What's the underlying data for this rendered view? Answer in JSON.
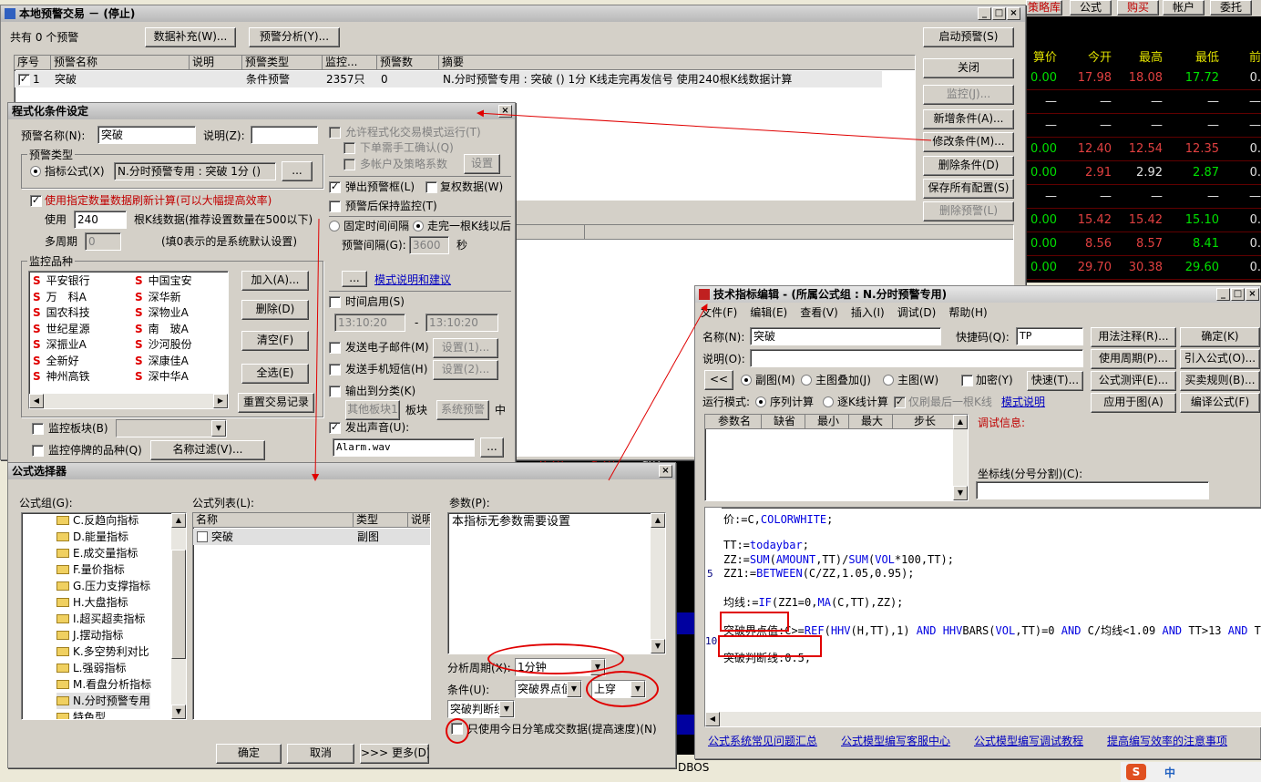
{
  "top_tabs": [
    "策略库",
    "公式",
    "购买",
    "帐户",
    "委托"
  ],
  "quote_header": [
    "算价",
    "今开",
    "最高",
    "最低",
    "前"
  ],
  "quote_rows": [
    [
      "0.00",
      "17.98",
      "18.08",
      "17.72",
      "0."
    ],
    [
      "—",
      "—",
      "—",
      "—",
      "—"
    ],
    [
      "—",
      "—",
      "—",
      "—",
      "—"
    ],
    [
      "0.00",
      "12.40",
      "12.54",
      "12.35",
      "0."
    ],
    [
      "0.00",
      "2.91",
      "2.92",
      "2.87",
      "0."
    ],
    [
      "—",
      "—",
      "—",
      "—",
      "—"
    ],
    [
      "0.00",
      "15.42",
      "15.42",
      "15.10",
      "0."
    ],
    [
      "0.00",
      "8.56",
      "8.57",
      "8.41",
      "0."
    ],
    [
      "0.00",
      "29.70",
      "30.38",
      "29.60",
      "0."
    ]
  ],
  "main_window": {
    "title": "本地预警交易 － (停止)",
    "count_label": "共有 0 个预警",
    "btn_supplement": "数据补充(W)...",
    "btn_analysis": "预警分析(Y)...",
    "btn_start": "启动预警(S)",
    "columns": [
      "序号",
      "预警名称",
      "说明",
      "预警类型",
      "监控...",
      "预警数",
      "摘要"
    ],
    "row": {
      "id": "1",
      "name": "突破",
      "desc": "",
      "type": "条件预警",
      "monitor": "2357只",
      "count": "0",
      "summary": "N.分时预警专用 : 突破 () 1分 K线走完再发信号 使用240根K线数据计算"
    },
    "right_buttons": [
      "关闭",
      "监控(J)...",
      "新增条件(A)...",
      "修改条件(M)...",
      "删除条件(D)",
      "保存所有配置(S)",
      "删除预警(L)"
    ]
  },
  "cond_dialog": {
    "title": "程式化条件设定",
    "name_label": "预警名称(N):",
    "name_value": "突破",
    "desc_label": "说明(Z):",
    "type_group": "预警类型",
    "formula_radio": "指标公式(X)",
    "formula_value": "N.分时预警专用 : 突破 1分 ()",
    "more": "...",
    "use_count_check": "使用指定数量数据刷新计算(可以大幅提高效率)",
    "use_label": "使用",
    "use_value": "240",
    "kline_label": "根K线数据(推荐设置数量在500以下)",
    "multi_label": "多周期",
    "multi_value": "0",
    "multi_note": "(填0表示的是系统默认设置)",
    "stock_group": "监控品种",
    "stocks_left": [
      "平安银行",
      "万　科A",
      "国农科技",
      "世纪星源",
      "深振业A",
      "全新好",
      "神州高铁"
    ],
    "stocks_right": [
      "中国宝安",
      "深华新",
      "深物业A",
      "南　玻A",
      "沙河股份",
      "深康佳A",
      "深中华A"
    ],
    "stock_buttons": [
      "加入(A)...",
      "删除(D)",
      "清空(F)",
      "全选(E)",
      "重置交易记录"
    ],
    "monitor_block": "监控板块(B)",
    "monitor_halted": "监控停牌的品种(Q)",
    "name_filter": "名称过滤(V)...",
    "allow_prog": "允许程式化交易模式运行(T)",
    "manual_confirm": "下单需手工确认(Q)",
    "multi_account": "多帐户及策略系数",
    "setup": "设置",
    "popup": "弹出预警框(L)",
    "rights": "复权数据(W)",
    "keep_monitor": "预警后保持监控(T)",
    "fixed_interval": "固定时间间隔",
    "bar_complete": "走完一根K线以后",
    "interval_label": "预警间隔(G):",
    "interval_value": "3600",
    "sec": "秒",
    "mode_link": "模式说明和建议",
    "time_enable": "时间启用(S)",
    "time_from": "13:10:20",
    "time_to": "13:10:20",
    "dash": "-",
    "send_email": "发送电子邮件(M)",
    "email_setup": "设置(1)...",
    "send_sms": "发送手机短信(H)",
    "sms_setup": "设置(2)...",
    "output_cat": "输出到分类(K)",
    "other_block": "其他板块1",
    "block_label": "板块",
    "sys_alert": "系统预警",
    "mid": "中",
    "sound": "发出声音(U):",
    "sound_file": "Alarm.wav"
  },
  "formula_selector": {
    "title": "公式选择器",
    "group_label": "公式组(G):",
    "groups": [
      "C.反趋向指标",
      "D.能量指标",
      "E.成交量指标",
      "F.量价指标",
      "G.压力支撑指标",
      "H.大盘指标",
      "I.超买超卖指标",
      "J.摆动指标",
      "K.多空势利对比",
      "L.强弱指标",
      "M.看盘分析指标",
      "N.分时预警专用",
      "特色型"
    ],
    "list_label": "公式列表(L):",
    "list_columns": [
      "名称",
      "类型",
      "说明"
    ],
    "list_row": {
      "name": "突破",
      "type": "副图"
    },
    "param_label": "参数(P):",
    "param_text": "本指标无参数需要设置",
    "period_label": "分析周期(X):",
    "period_value": "1分钟",
    "cond_label": "条件(U):",
    "cond_value": "突破界点值",
    "cross_value": "上穿",
    "line_value": "突破判断线",
    "only_today": "只使用今日分笔成交数据(提高速度)(N)",
    "ok": "确定",
    "cancel": "取消",
    "more": ">>> 更多(D)"
  },
  "editor": {
    "title": "技术指标编辑 - (所属公式组 : N.分时预警专用)",
    "menu": [
      "文件(F)",
      "编辑(E)",
      "查看(V)",
      "插入(I)",
      "调试(D)",
      "帮助(H)"
    ],
    "name_label": "名称(N):",
    "name_value": "突破",
    "shortcut_label": "快捷码(Q):",
    "shortcut_value": "TP",
    "desc_label": "说明(O):",
    "btn_usage": "用法注释(R)...",
    "btn_ok": "确定(K)",
    "btn_period": "使用周期(P)...",
    "btn_import": "引入公式(O)...",
    "btn_test": "公式测评(E)...",
    "btn_rules": "买卖规则(B)...",
    "btn_apply": "应用于图(A)",
    "btn_compile": "编译公式(F)",
    "nav": "<<",
    "r_sub": "副图(M)",
    "r_overlay": "主图叠加(J)",
    "r_main": "主图(W)",
    "encrypt": "加密(Y)",
    "quick": "快速(T)...",
    "run_mode": "运行模式:",
    "r_seq": "序列计算",
    "r_kline": "逐K线计算",
    "only_last": "仅刷最后一根K线",
    "mode_link": "模式说明",
    "param_cols": [
      "参数名",
      "缺省",
      "最小",
      "最大",
      "步长"
    ],
    "debug_label": "调试信息:",
    "coord_label": "坐标线(分号分割)(C):",
    "line5": "5",
    "line10": "10",
    "code_lines": [
      "价:=C,COLORWHITE;",
      "",
      "TT:=todaybar;",
      "ZZ:=SUM(AMOUNT,TT)/SUM(VOL*100,TT);",
      "ZZ1:=BETWEEN(C/ZZ,1.05,0.95);",
      "",
      "均线:=IF(ZZ1=0,MA(C,TT),ZZ);",
      "",
      "突破界点值:C>=REF(HHV(H,TT),1) AND HHVBARS(VOL,TT)=0 AND C/均线<1.09 AND TT>13 AND T",
      "",
      "突破判断线:0.5;"
    ],
    "links": [
      "公式系统常见问题汇总",
      "公式模型编写客服中心",
      "公式模型编写调试教程",
      "提高编写效率的注意事项"
    ]
  },
  "bg_numbers": [
    "6.2h",
    "9.2b",
    "962"
  ],
  "bottom": [
    "ME最",
    "DBOS"
  ],
  "tray": [
    "S",
    "中"
  ]
}
